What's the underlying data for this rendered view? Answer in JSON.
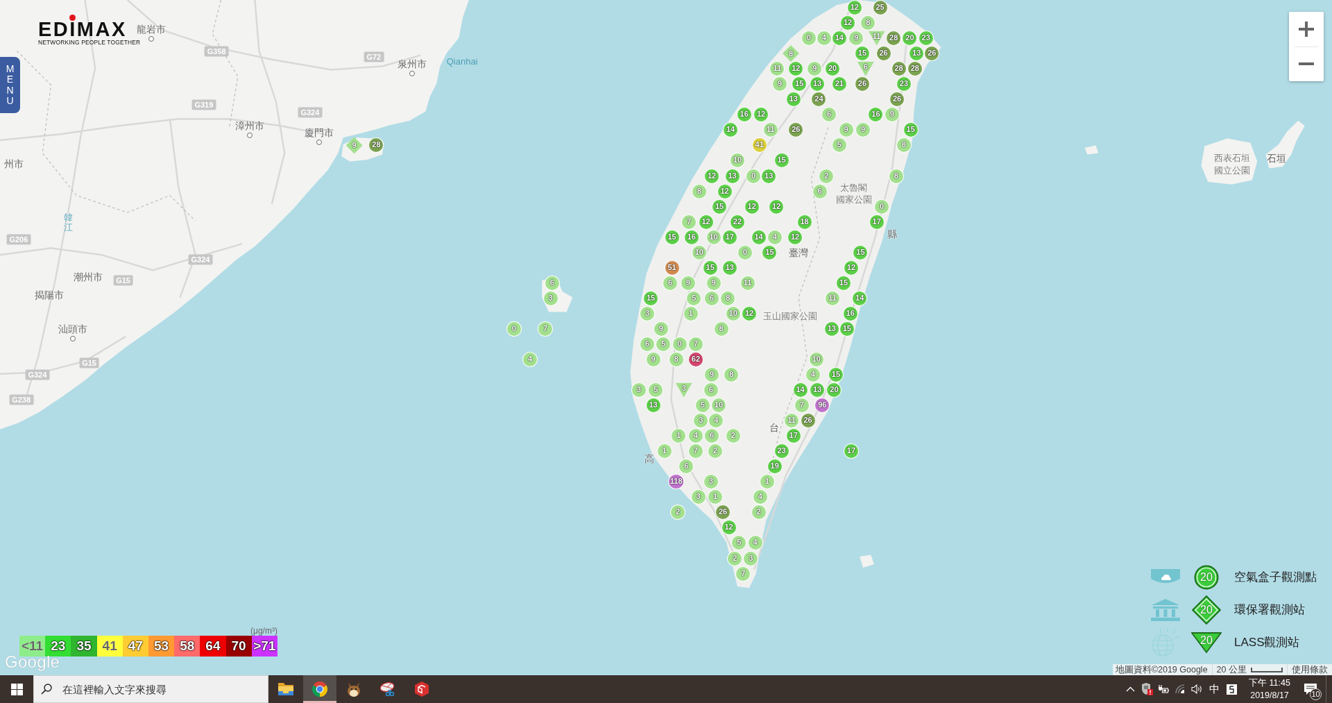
{
  "header": {
    "brand": "EDIMAX",
    "tagline": "NETWORKING PEOPLE TOGETHER",
    "menu": "MENU"
  },
  "map": {
    "places": [
      {
        "name": "龍岩市",
        "kind": "city"
      },
      {
        "name": "泉州市",
        "kind": "city"
      },
      {
        "name": "Qianhai",
        "kind": "sea"
      },
      {
        "name": "漳州市",
        "kind": "city"
      },
      {
        "name": "廈門市",
        "kind": "city"
      },
      {
        "name": "州市",
        "kind": "town"
      },
      {
        "name": "西表石垣",
        "kind": "park"
      },
      {
        "name": "石垣",
        "kind": "town"
      },
      {
        "name": "國立公園",
        "kind": "park"
      },
      {
        "name": "太魯閣",
        "kind": "park"
      },
      {
        "name": "國家公園",
        "kind": "park"
      },
      {
        "name": "韓江",
        "kind": "river"
      },
      {
        "name": "縣",
        "kind": "town"
      },
      {
        "name": "臺灣",
        "kind": "town"
      },
      {
        "name": "潮州市",
        "kind": "town"
      },
      {
        "name": "揭陽市",
        "kind": "town"
      },
      {
        "name": "玉山國家公園",
        "kind": "park"
      },
      {
        "name": "汕頭市",
        "kind": "city"
      },
      {
        "name": "台",
        "kind": "town"
      },
      {
        "name": "高",
        "kind": "town"
      }
    ],
    "road_shields": [
      "G358",
      "G72",
      "G319",
      "G324",
      "G206",
      "G324",
      "G15",
      "G324",
      "G15",
      "G238"
    ],
    "markers": [
      {
        "value": "12",
        "kind": "airbox",
        "color": "#5ccf48"
      },
      {
        "value": "25",
        "kind": "airbox",
        "color": "#7aa24f"
      },
      {
        "value": "12",
        "kind": "airbox",
        "color": "#5ccf48"
      },
      {
        "value": "8",
        "kind": "airbox",
        "color": "#a3e08e"
      },
      {
        "value": "0",
        "kind": "airbox",
        "color": "#a3e08e"
      },
      {
        "value": "4",
        "kind": "airbox",
        "color": "#a3e08e"
      },
      {
        "value": "14",
        "kind": "airbox",
        "color": "#5ccf48"
      },
      {
        "value": "9",
        "kind": "airbox",
        "color": "#a3e08e"
      },
      {
        "value": "11",
        "kind": "lass",
        "color": "#a3e08e"
      },
      {
        "value": "28",
        "kind": "airbox",
        "color": "#7aa24f"
      },
      {
        "value": "20",
        "kind": "airbox",
        "color": "#5ccf48"
      },
      {
        "value": "23",
        "kind": "airbox",
        "color": "#5ccf48"
      },
      {
        "value": "8",
        "kind": "epa",
        "color": "#a3e08e"
      },
      {
        "value": "15",
        "kind": "airbox",
        "color": "#5ccf48"
      },
      {
        "value": "26",
        "kind": "airbox",
        "color": "#7aa24f"
      },
      {
        "value": "13",
        "kind": "airbox",
        "color": "#5ccf48"
      },
      {
        "value": "26",
        "kind": "airbox",
        "color": "#7aa24f"
      },
      {
        "value": "11",
        "kind": "airbox",
        "color": "#a3e08e"
      },
      {
        "value": "12",
        "kind": "airbox",
        "color": "#5ccf48"
      },
      {
        "value": "9",
        "kind": "airbox",
        "color": "#a3e08e"
      },
      {
        "value": "20",
        "kind": "airbox",
        "color": "#5ccf48"
      },
      {
        "value": "6",
        "kind": "lass",
        "color": "#a3e08e"
      },
      {
        "value": "28",
        "kind": "airbox",
        "color": "#7aa24f"
      },
      {
        "value": "28",
        "kind": "airbox",
        "color": "#7aa24f"
      },
      {
        "value": "9",
        "kind": "airbox",
        "color": "#a3e08e"
      },
      {
        "value": "15",
        "kind": "airbox",
        "color": "#5ccf48"
      },
      {
        "value": "13",
        "kind": "airbox",
        "color": "#5ccf48"
      },
      {
        "value": "21",
        "kind": "airbox",
        "color": "#5ccf48"
      },
      {
        "value": "26",
        "kind": "airbox",
        "color": "#7aa24f"
      },
      {
        "value": "23",
        "kind": "airbox",
        "color": "#5ccf48"
      },
      {
        "value": "13",
        "kind": "airbox",
        "color": "#5ccf48"
      },
      {
        "value": "24",
        "kind": "airbox",
        "color": "#7aa24f"
      },
      {
        "value": "26",
        "kind": "airbox",
        "color": "#7aa24f"
      },
      {
        "value": "16",
        "kind": "airbox",
        "color": "#5ccf48"
      },
      {
        "value": "12",
        "kind": "airbox",
        "color": "#5ccf48"
      },
      {
        "value": "6",
        "kind": "airbox",
        "color": "#a3e08e"
      },
      {
        "value": "16",
        "kind": "airbox",
        "color": "#5ccf48"
      },
      {
        "value": "9",
        "kind": "airbox",
        "color": "#a3e08e"
      },
      {
        "value": "14",
        "kind": "airbox",
        "color": "#5ccf48"
      },
      {
        "value": "11",
        "kind": "airbox",
        "color": "#a3e08e"
      },
      {
        "value": "26",
        "kind": "airbox",
        "color": "#7aa24f"
      },
      {
        "value": "9",
        "kind": "airbox",
        "color": "#a3e08e"
      },
      {
        "value": "9",
        "kind": "airbox",
        "color": "#a3e08e"
      },
      {
        "value": "15",
        "kind": "airbox",
        "color": "#5ccf48"
      },
      {
        "value": "9",
        "kind": "epa",
        "color": "#a3e08e"
      },
      {
        "value": "28",
        "kind": "airbox",
        "color": "#7aa24f"
      },
      {
        "value": "41",
        "kind": "airbox",
        "color": "#d9cf3c"
      },
      {
        "value": "5",
        "kind": "airbox",
        "color": "#a3e08e"
      },
      {
        "value": "8",
        "kind": "airbox",
        "color": "#a3e08e"
      },
      {
        "value": "10",
        "kind": "airbox",
        "color": "#a3e08e"
      },
      {
        "value": "15",
        "kind": "airbox",
        "color": "#5ccf48"
      },
      {
        "value": "12",
        "kind": "airbox",
        "color": "#5ccf48"
      },
      {
        "value": "13",
        "kind": "airbox",
        "color": "#5ccf48"
      },
      {
        "value": "0",
        "kind": "airbox",
        "color": "#a3e08e"
      },
      {
        "value": "13",
        "kind": "airbox",
        "color": "#5ccf48"
      },
      {
        "value": "2",
        "kind": "airbox",
        "color": "#a3e08e"
      },
      {
        "value": "8",
        "kind": "airbox",
        "color": "#a3e08e"
      },
      {
        "value": "8",
        "kind": "airbox",
        "color": "#a3e08e"
      },
      {
        "value": "12",
        "kind": "airbox",
        "color": "#5ccf48"
      },
      {
        "value": "6",
        "kind": "airbox",
        "color": "#a3e08e"
      },
      {
        "value": "15",
        "kind": "airbox",
        "color": "#5ccf48"
      },
      {
        "value": "12",
        "kind": "airbox",
        "color": "#5ccf48"
      },
      {
        "value": "12",
        "kind": "airbox",
        "color": "#5ccf48"
      },
      {
        "value": "0",
        "kind": "airbox",
        "color": "#a3e08e"
      },
      {
        "value": "7",
        "kind": "airbox",
        "color": "#a3e08e"
      },
      {
        "value": "12",
        "kind": "airbox",
        "color": "#5ccf48"
      },
      {
        "value": "22",
        "kind": "airbox",
        "color": "#5ccf48"
      },
      {
        "value": "18",
        "kind": "airbox",
        "color": "#5ccf48"
      },
      {
        "value": "17",
        "kind": "airbox",
        "color": "#5ccf48"
      },
      {
        "value": "15",
        "kind": "airbox",
        "color": "#5ccf48"
      },
      {
        "value": "16",
        "kind": "airbox",
        "color": "#5ccf48"
      },
      {
        "value": "10",
        "kind": "airbox",
        "color": "#a3e08e"
      },
      {
        "value": "17",
        "kind": "airbox",
        "color": "#5ccf48"
      },
      {
        "value": "14",
        "kind": "airbox",
        "color": "#5ccf48"
      },
      {
        "value": "4",
        "kind": "airbox",
        "color": "#a3e08e"
      },
      {
        "value": "12",
        "kind": "airbox",
        "color": "#5ccf48"
      },
      {
        "value": "10",
        "kind": "airbox",
        "color": "#a3e08e"
      },
      {
        "value": "0",
        "kind": "airbox",
        "color": "#a3e08e"
      },
      {
        "value": "15",
        "kind": "airbox",
        "color": "#5ccf48"
      },
      {
        "value": "15",
        "kind": "airbox",
        "color": "#5ccf48"
      },
      {
        "value": "51",
        "kind": "airbox",
        "color": "#d08a50"
      },
      {
        "value": "15",
        "kind": "airbox",
        "color": "#5ccf48"
      },
      {
        "value": "13",
        "kind": "airbox",
        "color": "#5ccf48"
      },
      {
        "value": "12",
        "kind": "airbox",
        "color": "#5ccf48"
      },
      {
        "value": "6",
        "kind": "airbox",
        "color": "#a3e08e"
      },
      {
        "value": "6",
        "kind": "airbox",
        "color": "#a3e08e"
      },
      {
        "value": "9",
        "kind": "airbox",
        "color": "#a3e08e"
      },
      {
        "value": "9",
        "kind": "airbox",
        "color": "#a3e08e"
      },
      {
        "value": "11",
        "kind": "airbox",
        "color": "#a3e08e"
      },
      {
        "value": "15",
        "kind": "airbox",
        "color": "#5ccf48"
      },
      {
        "value": "3",
        "kind": "airbox",
        "color": "#a3e08e"
      },
      {
        "value": "15",
        "kind": "airbox",
        "color": "#5ccf48"
      },
      {
        "value": "5",
        "kind": "airbox",
        "color": "#a3e08e"
      },
      {
        "value": "6",
        "kind": "airbox",
        "color": "#a3e08e"
      },
      {
        "value": "8",
        "kind": "airbox",
        "color": "#a3e08e"
      },
      {
        "value": "11",
        "kind": "airbox",
        "color": "#a3e08e"
      },
      {
        "value": "14",
        "kind": "airbox",
        "color": "#5ccf48"
      },
      {
        "value": "3",
        "kind": "airbox",
        "color": "#a3e08e"
      },
      {
        "value": "1",
        "kind": "airbox",
        "color": "#a3e08e"
      },
      {
        "value": "10",
        "kind": "airbox",
        "color": "#a3e08e"
      },
      {
        "value": "12",
        "kind": "airbox",
        "color": "#5ccf48"
      },
      {
        "value": "16",
        "kind": "airbox",
        "color": "#5ccf48"
      },
      {
        "value": "0",
        "kind": "airbox",
        "color": "#a3e08e"
      },
      {
        "value": "7",
        "kind": "airbox",
        "color": "#a3e08e"
      },
      {
        "value": "9",
        "kind": "airbox",
        "color": "#a3e08e"
      },
      {
        "value": "8",
        "kind": "airbox",
        "color": "#a3e08e"
      },
      {
        "value": "13",
        "kind": "airbox",
        "color": "#5ccf48"
      },
      {
        "value": "15",
        "kind": "airbox",
        "color": "#5ccf48"
      },
      {
        "value": "6",
        "kind": "airbox",
        "color": "#a3e08e"
      },
      {
        "value": "5",
        "kind": "airbox",
        "color": "#a3e08e"
      },
      {
        "value": "0",
        "kind": "airbox",
        "color": "#a3e08e"
      },
      {
        "value": "7",
        "kind": "airbox",
        "color": "#a3e08e"
      },
      {
        "value": "4",
        "kind": "airbox",
        "color": "#a3e08e"
      },
      {
        "value": "9",
        "kind": "airbox",
        "color": "#a3e08e"
      },
      {
        "value": "8",
        "kind": "airbox",
        "color": "#a3e08e"
      },
      {
        "value": "62",
        "kind": "airbox",
        "color": "#d2456c"
      },
      {
        "value": "10",
        "kind": "airbox",
        "color": "#a3e08e"
      },
      {
        "value": "9",
        "kind": "airbox",
        "color": "#a3e08e"
      },
      {
        "value": "8",
        "kind": "airbox",
        "color": "#a3e08e"
      },
      {
        "value": "4",
        "kind": "airbox",
        "color": "#a3e08e"
      },
      {
        "value": "15",
        "kind": "airbox",
        "color": "#5ccf48"
      },
      {
        "value": "3",
        "kind": "airbox",
        "color": "#a3e08e"
      },
      {
        "value": "5",
        "kind": "airbox",
        "color": "#a3e08e"
      },
      {
        "value": "3",
        "kind": "lass",
        "color": "#a3e08e"
      },
      {
        "value": "6",
        "kind": "airbox",
        "color": "#a3e08e"
      },
      {
        "value": "14",
        "kind": "airbox",
        "color": "#5ccf48"
      },
      {
        "value": "13",
        "kind": "airbox",
        "color": "#5ccf48"
      },
      {
        "value": "20",
        "kind": "airbox",
        "color": "#5ccf48"
      },
      {
        "value": "13",
        "kind": "airbox",
        "color": "#5ccf48"
      },
      {
        "value": "5",
        "kind": "airbox",
        "color": "#a3e08e"
      },
      {
        "value": "10",
        "kind": "airbox",
        "color": "#a3e08e"
      },
      {
        "value": "7",
        "kind": "airbox",
        "color": "#a3e08e"
      },
      {
        "value": "96",
        "kind": "airbox",
        "color": "#bf72cc"
      },
      {
        "value": "3",
        "kind": "airbox",
        "color": "#a3e08e"
      },
      {
        "value": "4",
        "kind": "airbox",
        "color": "#a3e08e"
      },
      {
        "value": "11",
        "kind": "airbox",
        "color": "#a3e08e"
      },
      {
        "value": "26",
        "kind": "airbox",
        "color": "#7aa24f"
      },
      {
        "value": "1",
        "kind": "airbox",
        "color": "#a3e08e"
      },
      {
        "value": "4",
        "kind": "airbox",
        "color": "#a3e08e"
      },
      {
        "value": "6",
        "kind": "airbox",
        "color": "#a3e08e"
      },
      {
        "value": "2",
        "kind": "airbox",
        "color": "#a3e08e"
      },
      {
        "value": "17",
        "kind": "airbox",
        "color": "#5ccf48"
      },
      {
        "value": "1",
        "kind": "airbox",
        "color": "#a3e08e"
      },
      {
        "value": "7",
        "kind": "airbox",
        "color": "#a3e08e"
      },
      {
        "value": "2",
        "kind": "airbox",
        "color": "#a3e08e"
      },
      {
        "value": "23",
        "kind": "airbox",
        "color": "#5ccf48"
      },
      {
        "value": "17",
        "kind": "airbox",
        "color": "#5ccf48"
      },
      {
        "value": "6",
        "kind": "airbox",
        "color": "#a3e08e"
      },
      {
        "value": "19",
        "kind": "airbox",
        "color": "#5ccf48"
      },
      {
        "value": "118",
        "kind": "airbox",
        "color": "#bf72cc"
      },
      {
        "value": "3",
        "kind": "airbox",
        "color": "#a3e08e"
      },
      {
        "value": "1",
        "kind": "airbox",
        "color": "#a3e08e"
      },
      {
        "value": "3",
        "kind": "airbox",
        "color": "#a3e08e"
      },
      {
        "value": "1",
        "kind": "airbox",
        "color": "#a3e08e"
      },
      {
        "value": "4",
        "kind": "airbox",
        "color": "#a3e08e"
      },
      {
        "value": "2",
        "kind": "airbox",
        "color": "#a3e08e"
      },
      {
        "value": "26",
        "kind": "airbox",
        "color": "#7aa24f"
      },
      {
        "value": "2",
        "kind": "airbox",
        "color": "#a3e08e"
      },
      {
        "value": "12",
        "kind": "airbox",
        "color": "#5ccf48"
      },
      {
        "value": "5",
        "kind": "airbox",
        "color": "#a3e08e"
      },
      {
        "value": "4",
        "kind": "airbox",
        "color": "#a3e08e"
      },
      {
        "value": "2",
        "kind": "airbox",
        "color": "#a3e08e"
      },
      {
        "value": "3",
        "kind": "airbox",
        "color": "#a3e08e"
      },
      {
        "value": "7",
        "kind": "airbox",
        "color": "#a3e08e"
      }
    ]
  },
  "scale_legend": {
    "unit": "(μg/m³)",
    "levels": [
      {
        "label": "<11",
        "color": "#8eec8a"
      },
      {
        "label": "23",
        "color": "#33dd33"
      },
      {
        "label": "35",
        "color": "#2fb52f"
      },
      {
        "label": "41",
        "color": "#ffff3c"
      },
      {
        "label": "47",
        "color": "#ffcc33"
      },
      {
        "label": "53",
        "color": "#ff9a33"
      },
      {
        "label": "58",
        "color": "#ff6a6a"
      },
      {
        "label": "64",
        "color": "#ee0000"
      },
      {
        "label": "70",
        "color": "#990000"
      },
      {
        "label": ">71",
        "color": "#cc33ff"
      }
    ]
  },
  "station_legend": [
    {
      "kind": "airbox",
      "sample": "20",
      "label": "空氣盒子觀測點"
    },
    {
      "kind": "epa",
      "sample": "20",
      "label": "環保署觀測站"
    },
    {
      "kind": "lass",
      "sample": "20",
      "label": "LASS觀測站"
    }
  ],
  "google_logo": "Google",
  "attribution": {
    "data": "地圖資料©2019 Google",
    "scale": "20 公里",
    "terms": "使用條款"
  },
  "taskbar": {
    "search_placeholder": "在這裡輸入文字來搜尋",
    "apps": [
      {
        "kind": "explorer",
        "selected": false
      },
      {
        "kind": "chrome",
        "selected": true
      },
      {
        "kind": "creature",
        "selected": false
      },
      {
        "kind": "dish",
        "selected": false
      },
      {
        "kind": "cube",
        "selected": false
      }
    ],
    "ime": "中",
    "time": "下午 11:45",
    "date": "2019/8/17",
    "notifications": "10"
  }
}
